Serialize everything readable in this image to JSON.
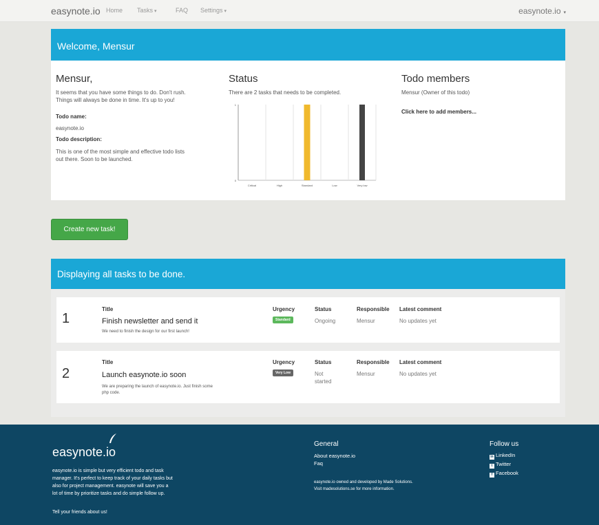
{
  "navbar": {
    "brand": "easynote.io",
    "links": [
      "Home",
      "Tasks",
      "FAQ",
      "Settings"
    ],
    "right": "easynote.io"
  },
  "welcome": {
    "header": "Welcome, Mensur",
    "greeting": "Mensur,",
    "message_line1": "It seems that you have some things to do. Don't rush.",
    "message_line2": "Things will always be done in time. It's up to you!",
    "todo_name_label": "Todo name:",
    "todo_name": "easynote.io",
    "todo_desc_label": "Todo description:",
    "todo_desc_line1": "This is one of the most simple and effective todo lists",
    "todo_desc_line2": "out there. Soon to be launched."
  },
  "status": {
    "title": "Status",
    "text": "There are 2 tasks that needs to be completed."
  },
  "members": {
    "title": "Todo members",
    "owner": "Mensur (Owner of this todo)",
    "add_link": "Click here to add members..."
  },
  "chart_data": {
    "type": "bar",
    "categories": [
      "Critical",
      "High",
      "Standard",
      "Low",
      "Very low"
    ],
    "values": [
      0,
      0,
      1,
      0,
      1
    ],
    "ylim": [
      0,
      1
    ],
    "yticks": [
      "1",
      "0"
    ],
    "colors": [
      "#f0b92d",
      "#f0b92d",
      "#f0b92d",
      "#444444",
      "#444444"
    ],
    "grid": true
  },
  "create_button": "Create new task!",
  "tasks": {
    "header": "Displaying all tasks to be done.",
    "col_title": "Title",
    "col_urgency": "Urgency",
    "col_status": "Status",
    "col_responsible": "Responsible",
    "col_comment": "Latest comment",
    "items": [
      {
        "num": "1",
        "title": "Finish newsletter and send it",
        "desc_line1": "We need to finish the design for our first launch!",
        "desc_line2": "",
        "urgency": "Standard",
        "urgency_color": "#5cb85c",
        "status_line1": "Ongoing",
        "status_line2": "",
        "responsible": "Mensur",
        "comment": "No updates yet"
      },
      {
        "num": "2",
        "title": "Launch easynote.io soon",
        "desc_line1": "We are preparing the launch of easynote.io. Just finish some",
        "desc_line2": "php code.",
        "urgency": "Very Low",
        "urgency_color": "#666666",
        "status_line1": "Not",
        "status_line2": "started",
        "responsible": "Mensur",
        "comment": "No updates yet"
      }
    ]
  },
  "footer": {
    "logo": "easynote.io",
    "about_line1": "easynote.io is simple but very efficient todo and task",
    "about_line2": "manager. It's perfect to keep track of your daily tasks but",
    "about_line3": "also for project management. easynote will save you a",
    "about_line4": "lot of time by prioritize tasks and do simple follow up.",
    "tell_friends": "Tell your friends about us!",
    "general_title": "General",
    "general_links": [
      "About easynote.io",
      "Faq"
    ],
    "owned_line1": "easynote.io owned and developed by Made Solutions.",
    "owned_line2": "Visit madesolutions.se for more information.",
    "follow_title": "Follow us",
    "social": [
      "LinkedIn",
      "Twitter",
      "Facebook"
    ]
  },
  "colors": {
    "primary": "#1aa7d6",
    "success": "#45a748",
    "footer": "#0e4663",
    "chart_bar": "#f0b92d",
    "chart_dark": "#444444"
  }
}
